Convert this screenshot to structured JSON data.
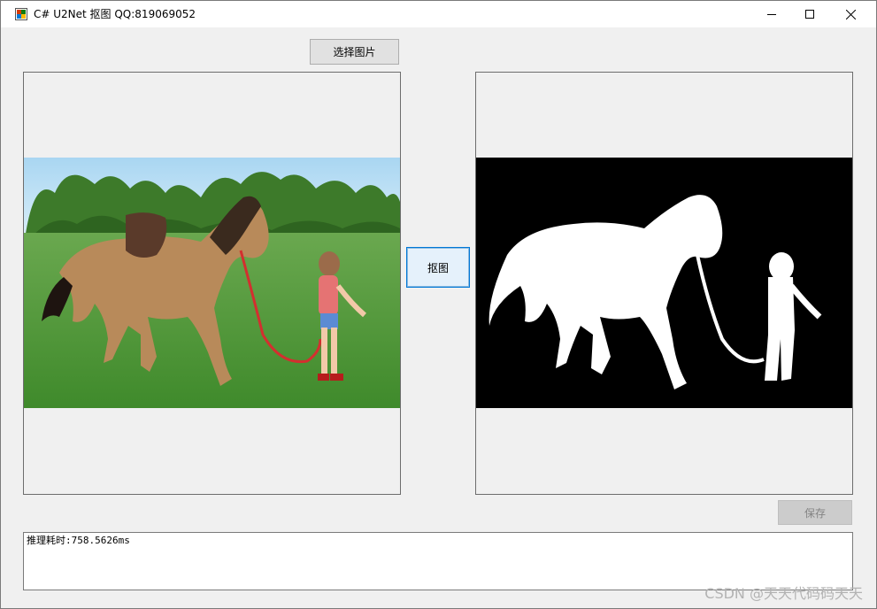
{
  "window": {
    "title": "C# U2Net 抠图 QQ:819069052",
    "icons": {
      "app": "app-icon",
      "minimize": "minimize-icon",
      "maximize": "maximize-icon",
      "close": "close-icon"
    }
  },
  "toolbar": {
    "select_image_label": "选择图片",
    "matting_label": "抠图",
    "save_label": "保存"
  },
  "images": {
    "left": "horse-and-girl-photo",
    "right": "horse-and-girl-mask"
  },
  "output": {
    "text": "推理耗时:758.5626ms"
  },
  "watermark": {
    "text": "CSDN @天天代码码天天"
  },
  "colors": {
    "window_bg": "#f0f0f0",
    "accent_border": "#0078d7",
    "mask_bg": "#000000",
    "mask_fg": "#ffffff"
  }
}
